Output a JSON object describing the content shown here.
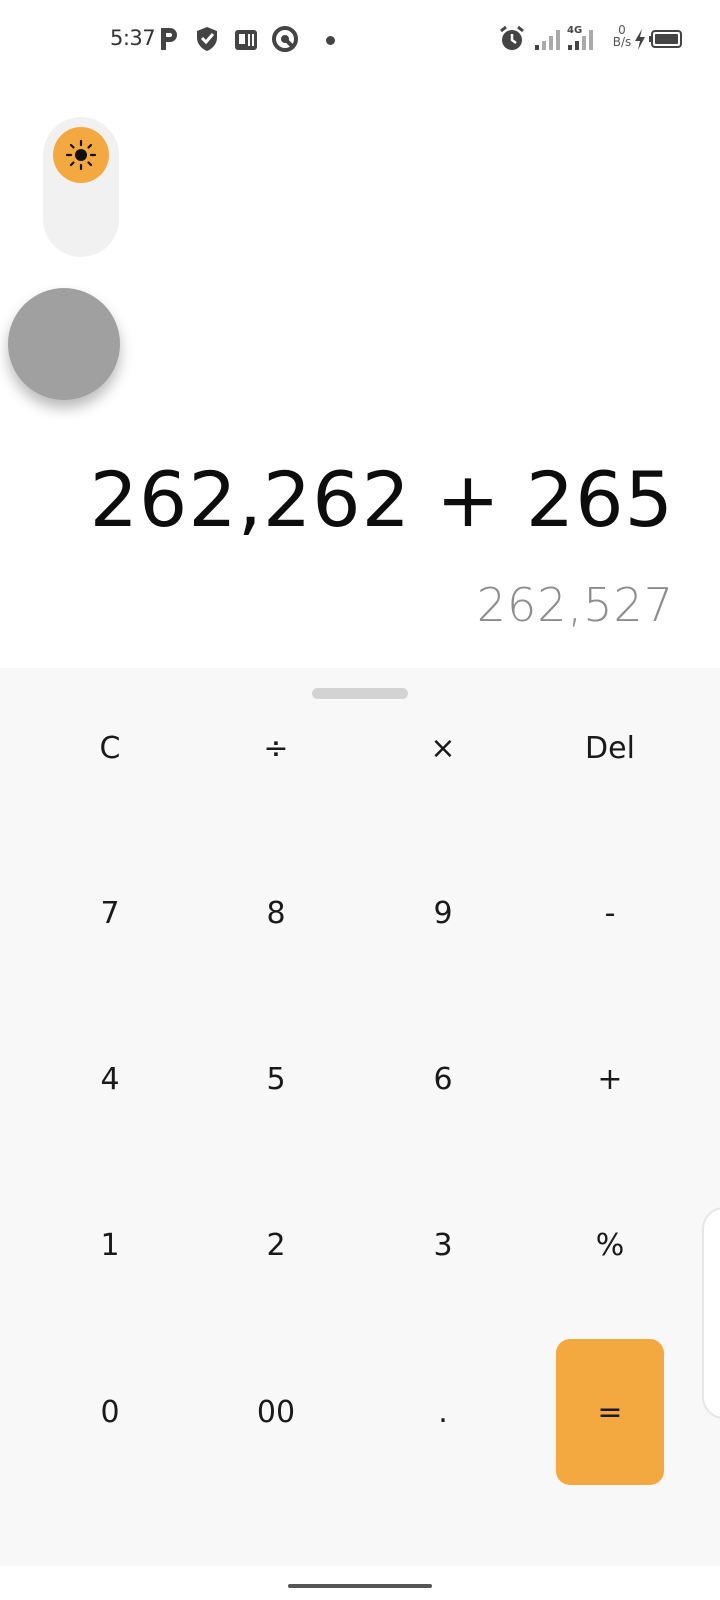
{
  "status_bar": {
    "time": "5:37",
    "network": "4G",
    "speed_value": "0",
    "speed_unit": "B/s"
  },
  "display": {
    "expression": "262,262 + 265",
    "result": "262,527"
  },
  "keypad": {
    "rows": [
      [
        "C",
        "÷",
        "×",
        "Del"
      ],
      [
        "7",
        "8",
        "9",
        "-"
      ],
      [
        "4",
        "5",
        "6",
        "+"
      ],
      [
        "1",
        "2",
        "3",
        "%"
      ],
      [
        "0",
        "00",
        ".",
        "="
      ]
    ]
  },
  "colors": {
    "accent": "#f4a940",
    "keypad_background": "#f8f8f8",
    "toggle_track": "#f1f1f1",
    "floating_button": "#a0a0a0"
  }
}
